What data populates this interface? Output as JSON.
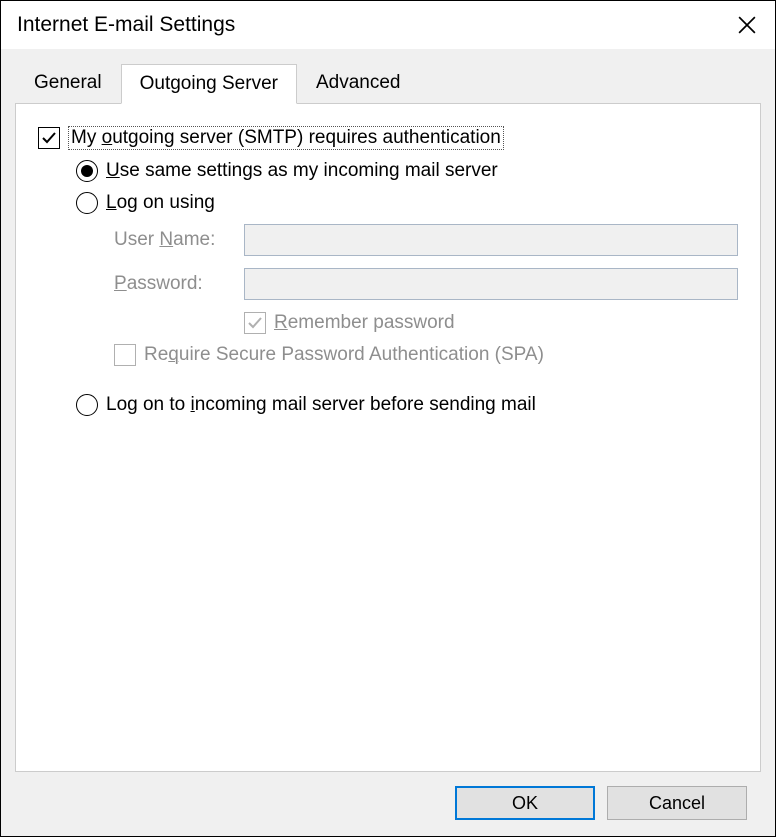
{
  "title": "Internet E-mail Settings",
  "tabs": {
    "general": "General",
    "outgoing": "Outgoing Server",
    "advanced": "Advanced"
  },
  "main_checkbox": {
    "pre": "My ",
    "u": "o",
    "post": "utgoing server (SMTP) requires authentication"
  },
  "radio_same": {
    "u": "U",
    "post": "se same settings as my incoming mail server"
  },
  "radio_logon": {
    "u": "L",
    "post": "og on using"
  },
  "fields": {
    "username": {
      "pre": "User ",
      "u": "N",
      "post": "ame:"
    },
    "password": {
      "u": "P",
      "post": "assword:"
    }
  },
  "remember": {
    "u": "R",
    "post": "emember password"
  },
  "spa": {
    "pre": "Re",
    "u": "q",
    "post": "uire Secure Password Authentication (SPA)"
  },
  "radio_incoming": {
    "pre": "Log on to ",
    "u": "i",
    "post": "ncoming mail server before sending mail"
  },
  "buttons": {
    "ok": "OK",
    "cancel": "Cancel"
  },
  "values": {
    "username": "",
    "password": ""
  }
}
